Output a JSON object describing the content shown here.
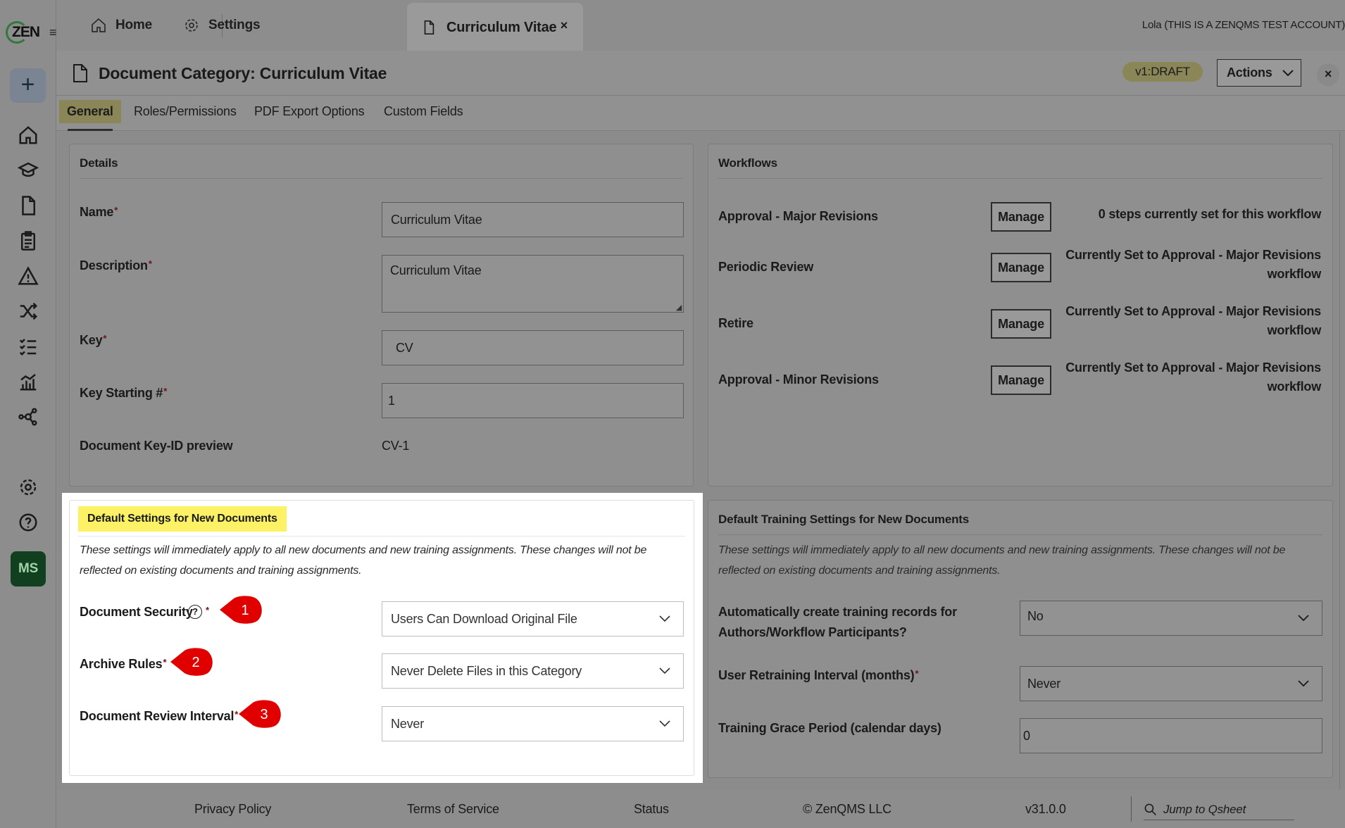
{
  "app": {
    "logo": "ZEN",
    "user": "Lola (THIS IS A ZENQMS TEST ACCOUNT)"
  },
  "tabs": {
    "home": "Home",
    "settings": "Settings",
    "active": "Curriculum Vitae",
    "close": "×"
  },
  "sidebar": {
    "plus": "+",
    "avatar": "MS",
    "icons": [
      "home-icon",
      "graduation-cap-icon",
      "document-icon",
      "clipboard-icon",
      "warning-icon",
      "shuffle-icon",
      "checklist-icon",
      "analytics-icon",
      "network-icon",
      "gear-icon",
      "help-icon"
    ]
  },
  "header": {
    "title": "Document Category: Curriculum Vitae",
    "version": "v1:DRAFT",
    "actions": "Actions",
    "close": "×"
  },
  "subtabs": [
    "General",
    "Roles/Permissions",
    "PDF Export Options",
    "Custom Fields"
  ],
  "details": {
    "heading": "Details",
    "name_label": "Name",
    "name_value": "Curriculum Vitae",
    "description_label": "Description",
    "description_value": "Curriculum Vitae",
    "key_label": "Key",
    "key_value": "CV",
    "key_start_label": "Key Starting #",
    "key_start_value": "1",
    "preview_label": "Document Key-ID preview",
    "preview_value": "CV-1",
    "required": "*"
  },
  "workflows": {
    "heading": "Workflows",
    "manage": "Manage",
    "rows": [
      {
        "name": "Approval - Major Revisions",
        "note1": "0 steps currently set for this workflow",
        "note2": ""
      },
      {
        "name": "Periodic Review",
        "note1": "Currently Set to Approval - Major Revisions",
        "note2": "workflow"
      },
      {
        "name": "Retire",
        "note1": "Currently Set to Approval - Major Revisions",
        "note2": "workflow"
      },
      {
        "name": "Approval - Minor Revisions",
        "note1": "Currently Set to Approval - Major Revisions",
        "note2": "workflow"
      }
    ]
  },
  "defaults": {
    "heading": "Default Settings for New Documents",
    "note_line1": "These settings will immediately apply to all new documents and new training assignments. These changes will not be",
    "note_line2": "reflected on existing documents and training assignments.",
    "security_label": "Document Security",
    "security_value": "Users Can Download Original File",
    "archive_label": "Archive Rules",
    "archive_value": "Never Delete Files in this Category",
    "review_label": "Document Review Interval",
    "review_value": "Never",
    "help": "?",
    "badges": [
      "1",
      "2",
      "3"
    ],
    "highlight_color": "#fdf266",
    "badge_color": "#e00000"
  },
  "training": {
    "heading": "Default Training Settings for New Documents",
    "note_line1": "These settings will immediately apply to all new documents and new training assignments. These changes will not be",
    "note_line2": "reflected on existing documents and training assignments.",
    "auto_label1": "Automatically create training records for",
    "auto_label2": "Authors/Workflow Participants?",
    "auto_value": "No",
    "retrain_label": "User Retraining Interval (months)",
    "retrain_value": "Never",
    "grace_label": "Training Grace Period (calendar days)",
    "grace_value": "0"
  },
  "footer": {
    "privacy": "Privacy Policy",
    "terms": "Terms of Service",
    "status": "Status",
    "copyright": "© ZenQMS LLC",
    "version": "v31.0.0",
    "jump": "Jump to Qsheet"
  }
}
